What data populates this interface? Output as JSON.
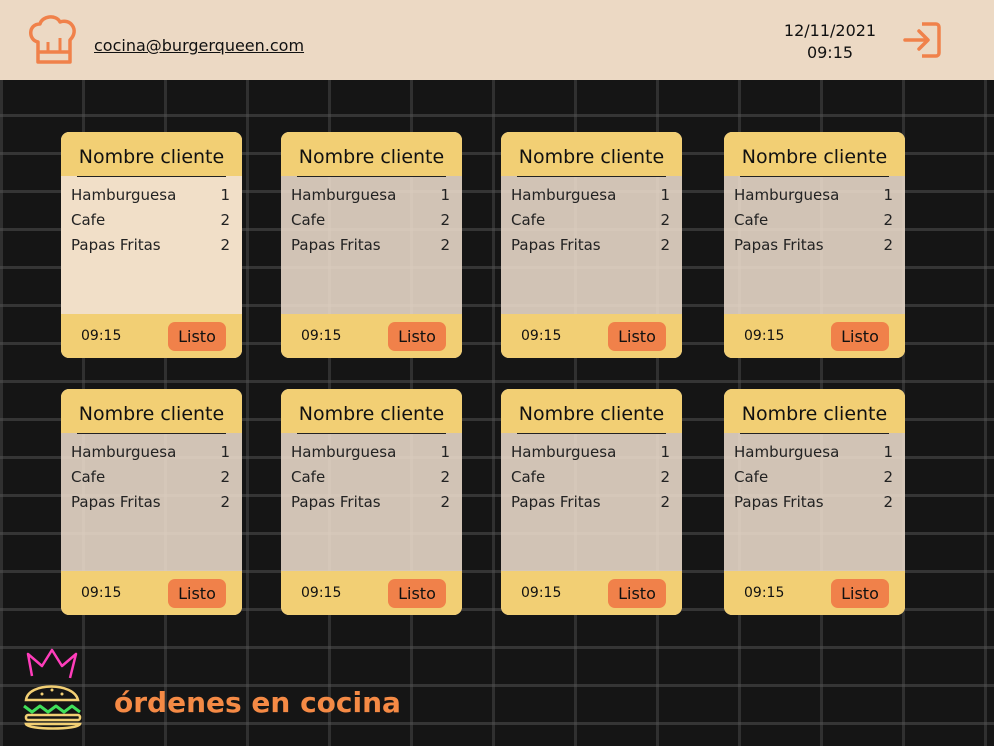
{
  "header": {
    "email": "cocina@burgerqueen.com",
    "date": "12/11/2021",
    "time": "09:15",
    "icons": {
      "profile": "chef-hat-icon",
      "logout": "logout-icon"
    }
  },
  "orders": [
    {
      "customer": "Nombre cliente",
      "items": [
        {
          "name": "Hamburguesa",
          "qty": "1"
        },
        {
          "name": "Cafe",
          "qty": "2"
        },
        {
          "name": "Papas Fritas",
          "qty": "2"
        }
      ],
      "time": "09:15",
      "button": "Listo"
    },
    {
      "customer": "Nombre cliente",
      "items": [
        {
          "name": "Hamburguesa",
          "qty": "1"
        },
        {
          "name": "Cafe",
          "qty": "2"
        },
        {
          "name": "Papas Fritas",
          "qty": "2"
        }
      ],
      "time": "09:15",
      "button": "Listo"
    },
    {
      "customer": "Nombre cliente",
      "items": [
        {
          "name": "Hamburguesa",
          "qty": "1"
        },
        {
          "name": "Cafe",
          "qty": "2"
        },
        {
          "name": "Papas Fritas",
          "qty": "2"
        }
      ],
      "time": "09:15",
      "button": "Listo"
    },
    {
      "customer": "Nombre cliente",
      "items": [
        {
          "name": "Hamburguesa",
          "qty": "1"
        },
        {
          "name": "Cafe",
          "qty": "2"
        },
        {
          "name": "Papas Fritas",
          "qty": "2"
        }
      ],
      "time": "09:15",
      "button": "Listo"
    },
    {
      "customer": "Nombre cliente",
      "items": [
        {
          "name": "Hamburguesa",
          "qty": "1"
        },
        {
          "name": "Cafe",
          "qty": "2"
        },
        {
          "name": "Papas Fritas",
          "qty": "2"
        }
      ],
      "time": "09:15",
      "button": "Listo"
    },
    {
      "customer": "Nombre cliente",
      "items": [
        {
          "name": "Hamburguesa",
          "qty": "1"
        },
        {
          "name": "Cafe",
          "qty": "2"
        },
        {
          "name": "Papas Fritas",
          "qty": "2"
        }
      ],
      "time": "09:15",
      "button": "Listo"
    },
    {
      "customer": "Nombre cliente",
      "items": [
        {
          "name": "Hamburguesa",
          "qty": "1"
        },
        {
          "name": "Cafe",
          "qty": "2"
        },
        {
          "name": "Papas Fritas",
          "qty": "2"
        }
      ],
      "time": "09:15",
      "button": "Listo"
    },
    {
      "customer": "Nombre cliente",
      "items": [
        {
          "name": "Hamburguesa",
          "qty": "1"
        },
        {
          "name": "Cafe",
          "qty": "2"
        },
        {
          "name": "Papas Fritas",
          "qty": "2"
        }
      ],
      "time": "09:15",
      "button": "Listo"
    }
  ],
  "footer": {
    "title": "órdenes en cocina",
    "logo_icon": "burger-crown-logo-icon"
  },
  "colors": {
    "header_bg": "#ecd9c4",
    "card_accent": "#f2cf74",
    "button": "#f0814a",
    "title": "#f58a45",
    "background": "#151515"
  }
}
